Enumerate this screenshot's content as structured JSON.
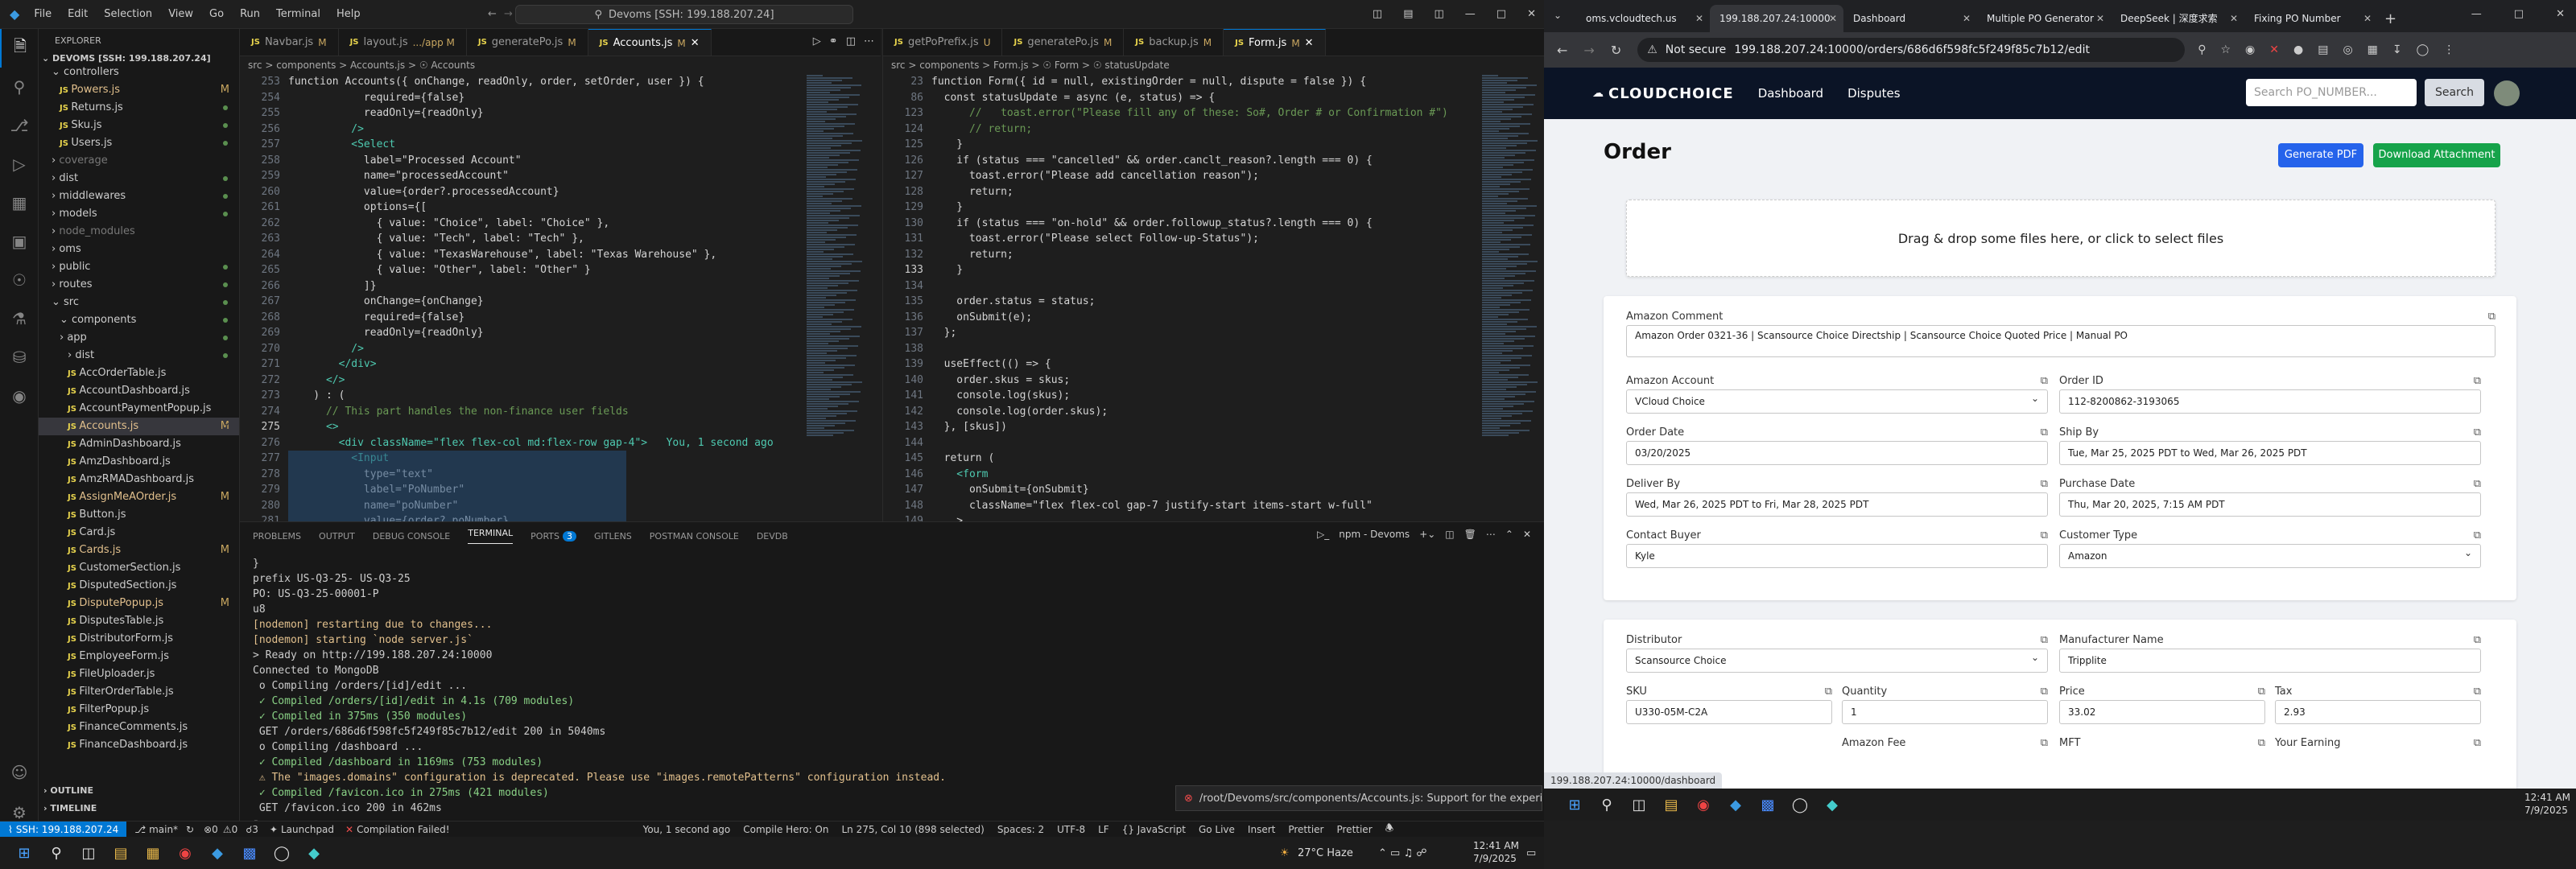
{
  "vscode": {
    "menu": [
      "File",
      "Edit",
      "Selection",
      "View",
      "Go",
      "Run",
      "Terminal",
      "Help"
    ],
    "command_center": "Devoms [SSH: 199.188.207.24]",
    "explorer_label": "EXPLORER",
    "root": "DEVOMS [SSH: 199.188.207.24]",
    "tree": [
      {
        "label": "controllers",
        "type": "folder",
        "open": true,
        "depth": 1
      },
      {
        "label": "Powers.js",
        "type": "file",
        "depth": 2,
        "badge": "M",
        "status": "modified"
      },
      {
        "label": "Returns.js",
        "type": "file",
        "depth": 2,
        "status": "dot"
      },
      {
        "label": "Sku.js",
        "type": "file",
        "depth": 2,
        "status": "dot"
      },
      {
        "label": "Users.js",
        "type": "file",
        "depth": 2,
        "status": "dot"
      },
      {
        "label": "coverage",
        "type": "folder",
        "depth": 1,
        "status": "dim"
      },
      {
        "label": "dist",
        "type": "folder",
        "depth": 1,
        "status": "dot"
      },
      {
        "label": "middlewares",
        "type": "folder",
        "depth": 1,
        "status": "dot"
      },
      {
        "label": "models",
        "type": "folder",
        "depth": 1,
        "status": "dot"
      },
      {
        "label": "node_modules",
        "type": "folder",
        "depth": 1,
        "status": "dim"
      },
      {
        "label": "oms",
        "type": "folder",
        "depth": 1
      },
      {
        "label": "public",
        "type": "folder",
        "depth": 1,
        "status": "dot"
      },
      {
        "label": "routes",
        "type": "folder",
        "depth": 1,
        "status": "dot"
      },
      {
        "label": "src",
        "type": "folder",
        "open": true,
        "depth": 1,
        "status": "dot"
      },
      {
        "label": "components",
        "type": "folder",
        "open": true,
        "depth": 2,
        "status": "dot"
      },
      {
        "label": "app",
        "type": "folder",
        "depth": 2,
        "status": "dot"
      },
      {
        "label": "dist",
        "type": "folder",
        "depth": 3,
        "status": "dot"
      },
      {
        "label": "AccOrderTable.js",
        "type": "file",
        "depth": 3
      },
      {
        "label": "AccountDashboard.js",
        "type": "file",
        "depth": 3
      },
      {
        "label": "AccountPaymentPopup.js",
        "type": "file",
        "depth": 3
      },
      {
        "label": "Accounts.js",
        "type": "file",
        "depth": 3,
        "badge": "M",
        "selected": true
      },
      {
        "label": "AdminDashboard.js",
        "type": "file",
        "depth": 3
      },
      {
        "label": "AmzDashboard.js",
        "type": "file",
        "depth": 3
      },
      {
        "label": "AmzRMADashboard.js",
        "type": "file",
        "depth": 3
      },
      {
        "label": "AssignMeAOrder.js",
        "type": "file",
        "depth": 3,
        "badge": "M",
        "status": "modified"
      },
      {
        "label": "Button.js",
        "type": "file",
        "depth": 3
      },
      {
        "label": "Card.js",
        "type": "file",
        "depth": 3
      },
      {
        "label": "Cards.js",
        "type": "file",
        "depth": 3,
        "badge": "M",
        "status": "modified"
      },
      {
        "label": "CustomerSection.js",
        "type": "file",
        "depth": 3
      },
      {
        "label": "DisputedSection.js",
        "type": "file",
        "depth": 3
      },
      {
        "label": "DisputePopup.js",
        "type": "file",
        "depth": 3,
        "badge": "M",
        "status": "modified"
      },
      {
        "label": "DisputesTable.js",
        "type": "file",
        "depth": 3
      },
      {
        "label": "DistributorForm.js",
        "type": "file",
        "depth": 3
      },
      {
        "label": "EmployeeForm.js",
        "type": "file",
        "depth": 3
      },
      {
        "label": "FileUploader.js",
        "type": "file",
        "depth": 3
      },
      {
        "label": "FilterOrderTable.js",
        "type": "file",
        "depth": 3
      },
      {
        "label": "FilterPopup.js",
        "type": "file",
        "depth": 3
      },
      {
        "label": "FinanceComments.js",
        "type": "file",
        "depth": 3
      },
      {
        "label": "FinanceDashboard.js",
        "type": "file",
        "depth": 3
      }
    ],
    "outline": "OUTLINE",
    "timeline": "TIMELINE",
    "left_tabs": [
      {
        "label": "Navbar.js",
        "badge": "M"
      },
      {
        "label": "layout.js",
        "badge": ".../app M"
      },
      {
        "label": "generatePo.js",
        "badge": "M"
      },
      {
        "label": "Accounts.js",
        "badge": "M",
        "active": true
      }
    ],
    "right_tabs": [
      {
        "label": "getPoPrefix.js",
        "badge": "U"
      },
      {
        "label": "generatePo.js",
        "badge": "M"
      },
      {
        "label": "backup.js",
        "badge": "M"
      },
      {
        "label": "Form.js",
        "badge": "M",
        "active": true
      }
    ],
    "left_crumbs": "src > components > Accounts.js > ☉ Accounts",
    "right_crumbs": "src > components > Form.js > ☉ Form > ☉ statusUpdate",
    "left_code": [
      {
        "n": "253",
        "t": "function Accounts({ onChange, readOnly, order, setOrder, user }) {"
      },
      {
        "n": "254",
        "t": "            required={false}"
      },
      {
        "n": "255",
        "t": "            readOnly={readOnly}"
      },
      {
        "n": "256",
        "t": "          />"
      },
      {
        "n": "257",
        "t": "          <Select"
      },
      {
        "n": "258",
        "t": "            label=\"Processed Account\""
      },
      {
        "n": "259",
        "t": "            name=\"processedAccount\""
      },
      {
        "n": "260",
        "t": "            value={order?.processedAccount}"
      },
      {
        "n": "261",
        "t": "            options={["
      },
      {
        "n": "262",
        "t": "              { value: \"Choice\", label: \"Choice\" },"
      },
      {
        "n": "263",
        "t": "              { value: \"Tech\", label: \"Tech\" },"
      },
      {
        "n": "264",
        "t": "              { value: \"TexasWarehouse\", label: \"Texas Warehouse\" },"
      },
      {
        "n": "265",
        "t": "              { value: \"Other\", label: \"Other\" }"
      },
      {
        "n": "266",
        "t": "            ]}"
      },
      {
        "n": "267",
        "t": "            onChange={onChange}"
      },
      {
        "n": "268",
        "t": "            required={false}"
      },
      {
        "n": "269",
        "t": "            readOnly={readOnly}"
      },
      {
        "n": "270",
        "t": "          />"
      },
      {
        "n": "271",
        "t": "        </div>"
      },
      {
        "n": "272",
        "t": "      </>"
      },
      {
        "n": "273",
        "t": "    ) : ("
      },
      {
        "n": "274",
        "t": "      // This part handles the non-finance user fields"
      },
      {
        "n": "275",
        "t": "      <>"
      },
      {
        "n": "276",
        "t": "        <div className=\"flex flex-col md:flex-row gap-4\">   You, 1 second ago"
      },
      {
        "n": "277",
        "t": "          <Input"
      },
      {
        "n": "278",
        "t": "            type=\"text\""
      },
      {
        "n": "279",
        "t": "            label=\"PoNumber\""
      },
      {
        "n": "280",
        "t": "            name=\"poNumber\""
      },
      {
        "n": "281",
        "t": "            value={order?.poNumber}"
      }
    ],
    "right_code": [
      {
        "n": "23",
        "t": "function Form({ id = null, existingOrder = null, dispute = false }) {"
      },
      {
        "n": "86",
        "t": "  const statusUpdate = async (e, status) => {"
      },
      {
        "n": "123",
        "t": "      //   toast.error(\"Please fill any of these: So#, Order # or Confirmation #\")"
      },
      {
        "n": "124",
        "t": "      // return;"
      },
      {
        "n": "125",
        "t": "    }"
      },
      {
        "n": "126",
        "t": "    if (status === \"cancelled\" && order.canclt_reason?.length === 0) {"
      },
      {
        "n": "127",
        "t": "      toast.error(\"Please add cancellation reason\");"
      },
      {
        "n": "128",
        "t": "      return;"
      },
      {
        "n": "129",
        "t": "    }"
      },
      {
        "n": "130",
        "t": "    if (status === \"on-hold\" && order.followup_status?.length === 0) {"
      },
      {
        "n": "131",
        "t": "      toast.error(\"Please select Follow-up-Status\");"
      },
      {
        "n": "132",
        "t": "      return;"
      },
      {
        "n": "133",
        "t": "    }"
      },
      {
        "n": "134",
        "t": ""
      },
      {
        "n": "135",
        "t": "    order.status = status;"
      },
      {
        "n": "136",
        "t": "    onSubmit(e);"
      },
      {
        "n": "137",
        "t": "  };"
      },
      {
        "n": "138",
        "t": ""
      },
      {
        "n": "139",
        "t": "  useEffect(() => {"
      },
      {
        "n": "140",
        "t": "    order.skus = skus;"
      },
      {
        "n": "141",
        "t": "    console.log(skus);"
      },
      {
        "n": "142",
        "t": "    console.log(order.skus);"
      },
      {
        "n": "143",
        "t": "  }, [skus])"
      },
      {
        "n": "144",
        "t": ""
      },
      {
        "n": "145",
        "t": "  return ("
      },
      {
        "n": "146",
        "t": "    <form"
      },
      {
        "n": "147",
        "t": "      onSubmit={onSubmit}"
      },
      {
        "n": "148",
        "t": "      className=\"flex flex-col gap-7 justify-start items-start w-full\""
      },
      {
        "n": "149",
        "t": "    >"
      }
    ],
    "panel_tabs": [
      "PROBLEMS",
      "OUTPUT",
      "DEBUG CONSOLE",
      "TERMINAL",
      "PORTS",
      "GITLENS",
      "POSTMAN CONSOLE",
      "DEVDB"
    ],
    "ports_count": "3",
    "terminal_name": "npm - Devoms",
    "terminal_lines": [
      "}",
      "prefix US-Q3-25- US-Q3-25",
      "PO: US-Q3-25-00001-P",
      "u8",
      "[nodemon] restarting due to changes...",
      "[nodemon] starting `node server.js`",
      "> Ready on http://199.188.207.24:10000",
      "Connected to MongoDB",
      " o Compiling /orders/[id]/edit ...",
      " ✓ Compiled /orders/[id]/edit in 4.1s (709 modules)",
      " ✓ Compiled in 375ms (350 modules)",
      " GET /orders/686d6f598fc5f249f85c7b12/edit 200 in 5040ms",
      " o Compiling /dashboard ...",
      " ✓ Compiled /dashboard in 1169ms (753 modules)",
      " ⚠ The \"images.domains\" configuration is deprecated. Please use \"images.remotePatterns\" configuration instead.",
      " ✓ Compiled /favicon.ico in 275ms (421 modules)",
      " GET /favicon.ico 200 in 462ms",
      "▯"
    ],
    "notification": "/root/Devoms/src/components/Accounts.js: Support for the experime...",
    "status": {
      "remote": "SSH: 199.188.207.24",
      "branch": "main*",
      "sync": "↻",
      "errors": "0",
      "warnings": "0",
      "ports": "3",
      "launchpad": "Launchpad",
      "compile": "Compilation Failed!",
      "blame": "You, 1 second ago",
      "compile_hero": "Compile Hero: On",
      "position": "Ln 275, Col 10 (898 selected)",
      "spaces": "Spaces: 2",
      "encoding": "UTF-8",
      "eol": "LF",
      "lang": "{} JavaScript",
      "golive": "Go Live",
      "insert": "Insert",
      "prettier": "Prettier",
      "prettier2": "Prettier"
    }
  },
  "chrome": {
    "tabs": [
      {
        "label": "oms.vcloudtech.us"
      },
      {
        "label": "199.188.207.24:10000",
        "active": true
      },
      {
        "label": "Dashboard"
      },
      {
        "label": "Multiple PO Generator"
      },
      {
        "label": "DeepSeek | 深度求索"
      },
      {
        "label": "Fixing PO Number"
      }
    ],
    "not_secure": "Not secure",
    "url": "199.188.207.24:10000/orders/686d6f598fc5f249f85c7b12/edit",
    "status_url": "199.188.207.24:10000/dashboard"
  },
  "app": {
    "logo": "CLOUDCHOICE",
    "nav": [
      "Dashboard",
      "Disputes"
    ],
    "search_placeholder": "Search PO_NUMBER...",
    "search_button": "Search",
    "title": "Order",
    "generate_pdf": "Generate PDF",
    "download_attachment": "Download Attachment",
    "dropzone": "Drag & drop some files here, or click to select files",
    "colors": {
      "pdf": "#2563eb",
      "download": "#16a34a",
      "nav": "#0b1426"
    },
    "fields": {
      "amazon_comment": {
        "label": "Amazon Comment",
        "value": "Amazon Order 0321-36 | Scansource Choice Directship | Scansource Choice Quoted Price | Manual PO"
      },
      "amazon_account": {
        "label": "Amazon Account",
        "value": "VCloud Choice"
      },
      "order_id": {
        "label": "Order ID",
        "value": "112-8200862-3193065"
      },
      "order_date": {
        "label": "Order Date",
        "value": "03/20/2025"
      },
      "ship_by": {
        "label": "Ship By",
        "value": "Tue, Mar 25, 2025 PDT to Wed, Mar 26, 2025 PDT"
      },
      "deliver_by": {
        "label": "Deliver By",
        "value": "Wed, Mar 26, 2025 PDT to Fri, Mar 28, 2025 PDT"
      },
      "purchase_date": {
        "label": "Purchase Date",
        "value": "Thu, Mar 20, 2025, 7:15 AM PDT"
      },
      "contact_buyer": {
        "label": "Contact Buyer",
        "value": "Kyle"
      },
      "customer_type": {
        "label": "Customer Type",
        "value": "Amazon"
      },
      "distributor": {
        "label": "Distributor",
        "value": "Scansource Choice"
      },
      "manufacturer": {
        "label": "Manufacturer Name",
        "value": "Tripplite"
      },
      "sku": {
        "label": "SKU",
        "value": "U330-05M-C2A"
      },
      "quantity": {
        "label": "Quantity",
        "value": "1"
      },
      "price": {
        "label": "Price",
        "value": "33.02"
      },
      "tax": {
        "label": "Tax",
        "value": "2.93"
      },
      "amazon_fee": {
        "label": "Amazon Fee"
      },
      "mft": {
        "label": "MFT"
      },
      "your_earning": {
        "label": "Your Earning"
      }
    }
  },
  "taskbar": {
    "weather": "27°C Haze",
    "time_left": "12:41 AM",
    "date_left": "7/9/2025",
    "time_right": "12:41 AM",
    "date_right": "7/9/2025"
  }
}
